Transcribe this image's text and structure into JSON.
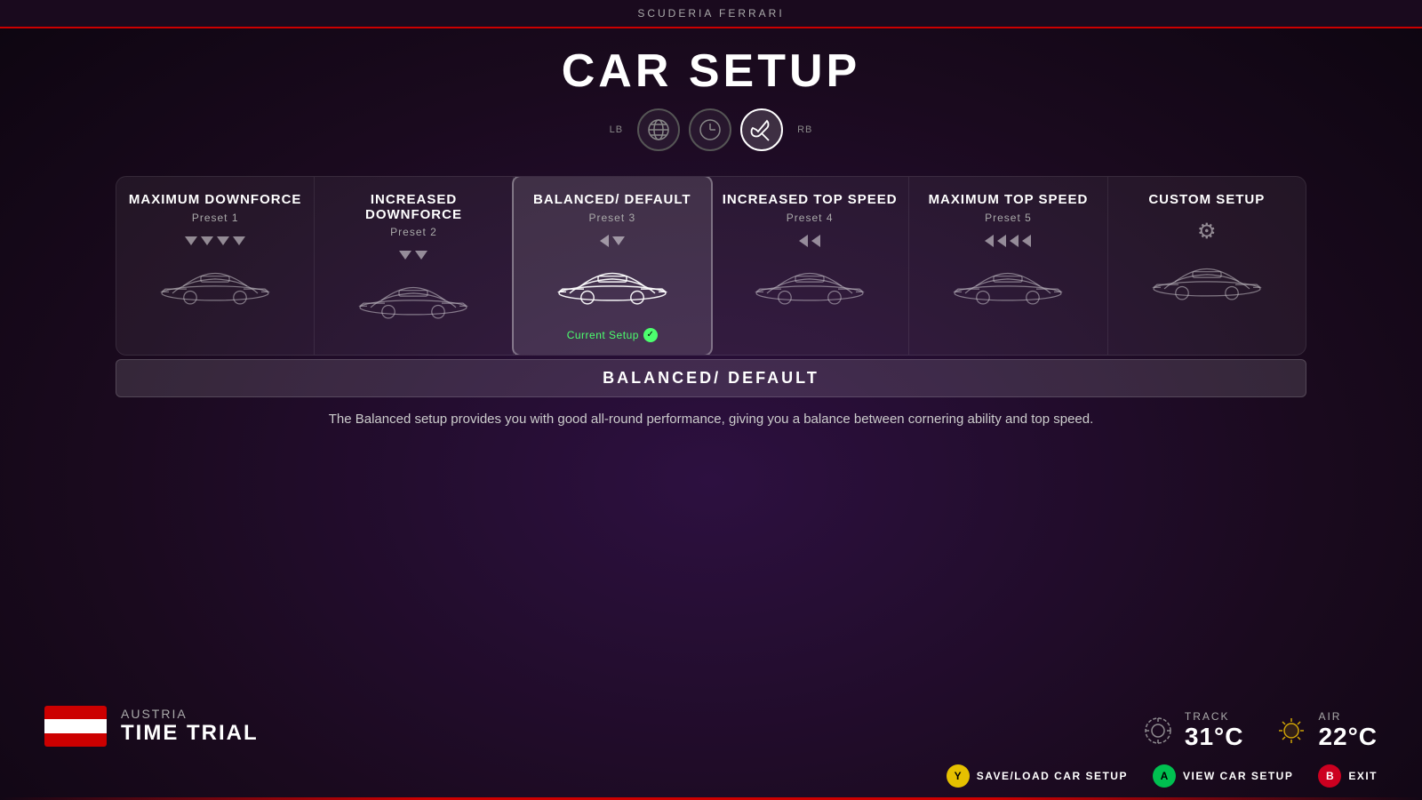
{
  "header": {
    "team": "SCUDERIA FERRARI",
    "title": "CAR SETUP"
  },
  "tabs": [
    {
      "id": "lb",
      "label": "LB",
      "icon": ""
    },
    {
      "id": "globe",
      "label": "globe",
      "icon": "🌐"
    },
    {
      "id": "clock",
      "label": "clock",
      "icon": "⏱"
    },
    {
      "id": "wrench",
      "label": "wrench",
      "icon": "🔧",
      "active": true
    },
    {
      "id": "rb",
      "label": "RB",
      "icon": ""
    }
  ],
  "presets": [
    {
      "id": "preset1",
      "title": "MAXIMUM DOWNFORCE",
      "subtitle": "Preset 1",
      "arrows": "down4",
      "active": false
    },
    {
      "id": "preset2",
      "title": "INCREASED DOWNFORCE",
      "subtitle": "Preset 2",
      "arrows": "down2",
      "active": false
    },
    {
      "id": "preset3",
      "title": "BALANCED/ DEFAULT",
      "subtitle": "Preset 3",
      "arrows": "mixed",
      "active": true,
      "currentSetup": true
    },
    {
      "id": "preset4",
      "title": "INCREASED TOP SPEED",
      "subtitle": "Preset 4",
      "arrows": "left2",
      "active": false
    },
    {
      "id": "preset5",
      "title": "MAXIMUM TOP SPEED",
      "subtitle": "Preset 5",
      "arrows": "left4",
      "active": false
    },
    {
      "id": "custom",
      "title": "CUSTOM SETUP",
      "subtitle": "",
      "arrows": "gear",
      "active": false
    }
  ],
  "selected": {
    "title": "BALANCED/ DEFAULT",
    "description": "The Balanced setup provides you with good all-round performance, giving you a balance between cornering ability and top speed."
  },
  "currentSetupLabel": "Current Setup",
  "location": {
    "country": "AUSTRIA",
    "event": "TIME TRIAL",
    "flag": {
      "colors": [
        "#cc0000",
        "#fff",
        "#cc0000"
      ]
    }
  },
  "weather": {
    "track": {
      "label": "TRACK",
      "value": "31°C",
      "icon": "⏱"
    },
    "air": {
      "label": "AIR",
      "value": "22°C",
      "icon": "☀"
    }
  },
  "actions": [
    {
      "id": "save",
      "btn": "Y",
      "btnClass": "btn-yellow",
      "label": "SAVE/LOAD CAR SETUP"
    },
    {
      "id": "view",
      "btn": "A",
      "btnClass": "btn-green",
      "label": "VIEW CAR SETUP"
    },
    {
      "id": "exit",
      "btn": "B",
      "btnClass": "btn-red",
      "label": "EXIT"
    }
  ]
}
